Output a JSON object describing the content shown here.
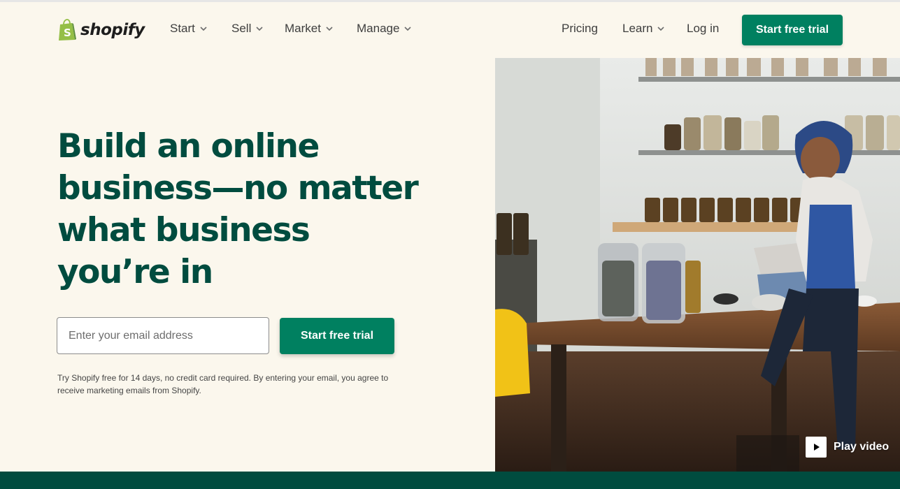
{
  "header": {
    "logo_text": "shopify",
    "nav_left": [
      {
        "label": "Start"
      },
      {
        "label": "Sell"
      },
      {
        "label": "Market"
      },
      {
        "label": "Manage"
      }
    ],
    "nav_right": {
      "pricing": "Pricing",
      "learn": "Learn",
      "login": "Log in",
      "cta": "Start free trial"
    }
  },
  "hero": {
    "title": "Build an online\nbusiness—no matter\nwhat business\nyou’re in",
    "email_placeholder": "Enter your email address",
    "cta": "Start free trial",
    "disclaimer": "Try Shopify free for 14 days, no credit card required. By entering your email, you agree to receive marketing emails from Shopify."
  },
  "media": {
    "play_label": "Play video",
    "icons": [
      "shopping-bag-icon",
      "chevron-down-icon",
      "play-icon"
    ]
  },
  "colors": {
    "brand_green": "#008060",
    "dark_green": "#004c3f",
    "background": "#fbf7ed",
    "logo_green": "#95bf47"
  }
}
